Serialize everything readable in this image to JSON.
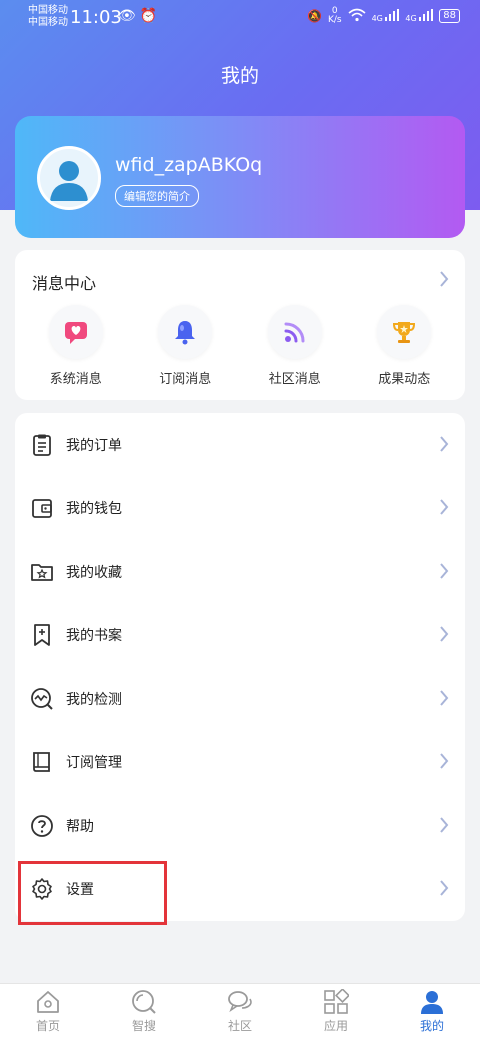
{
  "status_bar": {
    "carrier_1": "中国移动",
    "carrier_2": "中国移动",
    "time": "11:03",
    "speed_value": "0",
    "speed_unit": "K/s",
    "signal_1": "4G",
    "signal_2": "4G",
    "battery": "88"
  },
  "header": {
    "title": "我的"
  },
  "profile": {
    "username": "wfid_zapABKOq",
    "edit_label": "编辑您的简介"
  },
  "message_center": {
    "title": "消息中心",
    "items": [
      {
        "label": "系统消息",
        "icon": "message-heart-icon"
      },
      {
        "label": "订阅消息",
        "icon": "bell-icon"
      },
      {
        "label": "社区消息",
        "icon": "feed-icon"
      },
      {
        "label": "成果动态",
        "icon": "trophy-icon"
      }
    ]
  },
  "menu": [
    {
      "label": "我的订单",
      "icon": "order-clipboard-icon"
    },
    {
      "label": "我的钱包",
      "icon": "wallet-icon"
    },
    {
      "label": "我的收藏",
      "icon": "favorites-folder-icon"
    },
    {
      "label": "我的书案",
      "icon": "bookmark-plus-icon"
    },
    {
      "label": "我的检测",
      "icon": "detection-icon"
    },
    {
      "label": "订阅管理",
      "icon": "book-icon"
    },
    {
      "label": "帮助",
      "icon": "help-icon"
    },
    {
      "label": "设置",
      "icon": "gear-icon"
    }
  ],
  "bottom_nav": [
    {
      "label": "首页",
      "icon": "home-icon"
    },
    {
      "label": "智搜",
      "icon": "search-icon"
    },
    {
      "label": "社区",
      "icon": "chat-icon"
    },
    {
      "label": "应用",
      "icon": "apps-icon"
    },
    {
      "label": "我的",
      "icon": "user-icon",
      "active": true
    }
  ],
  "colors": {
    "accent": "#2b6fd6",
    "highlight": "#e3343a"
  }
}
